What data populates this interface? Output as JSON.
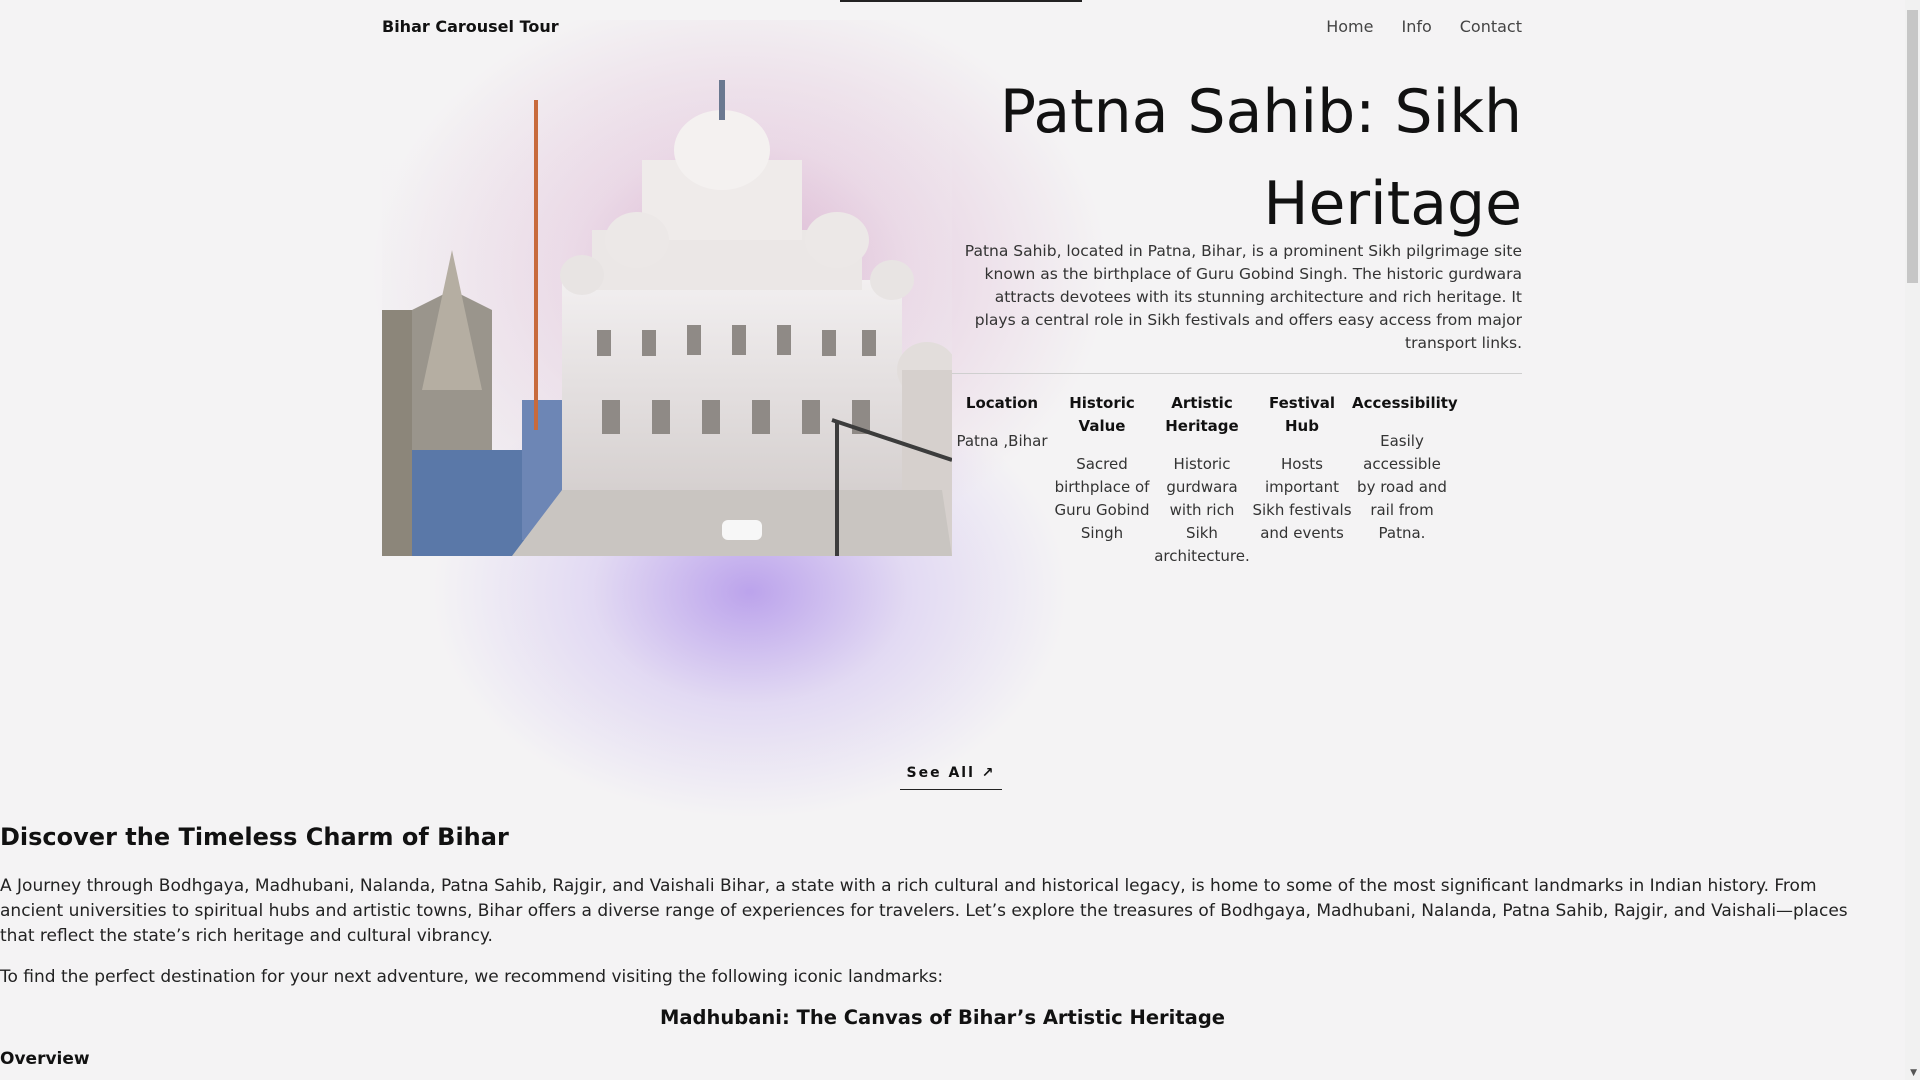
{
  "header": {
    "brand": "Bihar Carousel Tour",
    "nav": [
      "Home",
      "Info",
      "Contact"
    ]
  },
  "hero": {
    "title": "Patna Sahib: Sikh Heritage",
    "description": "Patna Sahib, located in Patna, Bihar, is a prominent Sikh pilgrimage site known as the birthplace of Guru Gobind Singh. The historic gurdwara attracts devotees with its stunning architecture and rich heritage. It plays a central role in Sikh festivals and offers easy access from major transport links.",
    "features": [
      {
        "title": "Location",
        "text": "Patna ,Bihar"
      },
      {
        "title": "Historic Value",
        "text": "Sacred birthplace of Guru Gobind Singh"
      },
      {
        "title": "Artistic Heritage",
        "text": "Historic gurdwara with rich Sikh architecture."
      },
      {
        "title": "Festival Hub",
        "text": "Hosts important Sikh festivals and events"
      },
      {
        "title": "Accessibility",
        "text": "Easily accessible by road and rail from Patna."
      }
    ],
    "see_all": "See All ↗"
  },
  "content": {
    "heading": "Discover the Timeless Charm of Bihar",
    "paragraph1": "A Journey through Bodhgaya, Madhubani, Nalanda, Patna Sahib, Rajgir, and Vaishali Bihar, a state with a rich cultural and historical legacy, is home to some of the most significant landmarks in Indian history. From ancient universities to spiritual hubs and artistic towns, Bihar offers a diverse range of experiences for travelers. Let’s explore the treasures of Bodhgaya, Madhubani, Nalanda, Patna Sahib, Rajgir, and Vaishali—places that reflect the state’s rich heritage and cultural vibrancy.",
    "paragraph2": "To find the perfect destination for your next adventure, we recommend visiting the following iconic landmarks:",
    "subheading": "Madhubani: The Canvas of Bihar’s Artistic Heritage",
    "overview": "Overview"
  },
  "colors": {
    "background": "#f4f3f4",
    "glow_pink": "#be6eaa",
    "glow_purple": "#966ee6"
  }
}
